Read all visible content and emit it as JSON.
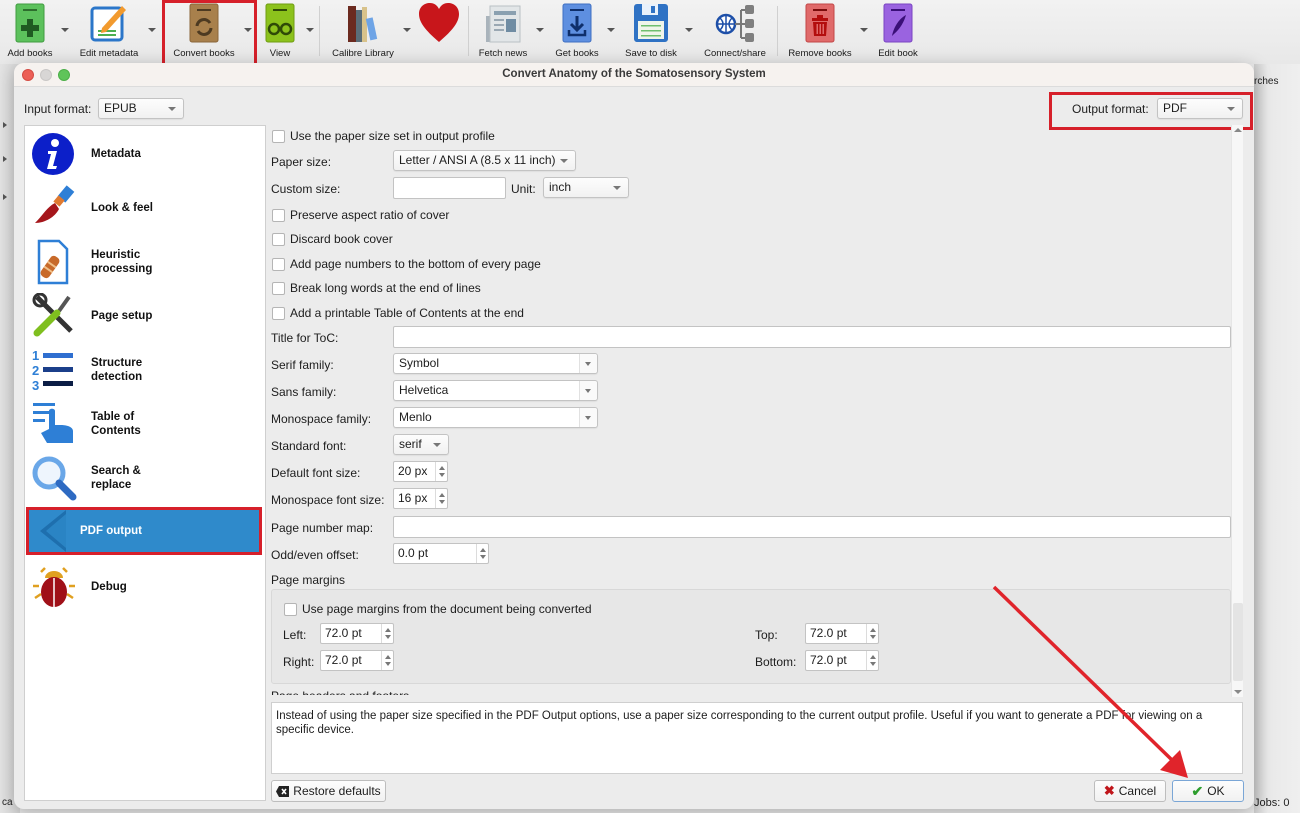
{
  "toolbar": {
    "items": [
      {
        "label": "Add books",
        "icon": "add-books-icon"
      },
      {
        "label": "Edit metadata",
        "icon": "edit-metadata-icon"
      },
      {
        "label": "Convert books",
        "icon": "convert-books-icon"
      },
      {
        "label": "View",
        "icon": "view-icon"
      },
      {
        "label": "Calibre Library",
        "icon": "library-icon"
      },
      {
        "label": "",
        "icon": "heart-icon"
      },
      {
        "label": "Fetch news",
        "icon": "fetch-news-icon"
      },
      {
        "label": "Get books",
        "icon": "get-books-icon"
      },
      {
        "label": "Save to disk",
        "icon": "save-to-disk-icon"
      },
      {
        "label": "Connect/share",
        "icon": "connect-share-icon"
      },
      {
        "label": "Remove books",
        "icon": "remove-books-icon"
      },
      {
        "label": "Edit book",
        "icon": "edit-book-icon"
      }
    ]
  },
  "background": {
    "searches_partial": "rches",
    "jobs": "Jobs: 0",
    "bottom_left_partial": "ca"
  },
  "dialog": {
    "title": "Convert Anatomy of the Somatosensory System",
    "input_format_label": "Input format:",
    "input_format_value": "EPUB",
    "output_format_label": "Output format:",
    "output_format_value": "PDF",
    "sidebar": [
      {
        "label": "Metadata",
        "icon": "info-icon"
      },
      {
        "label": "Look & feel",
        "icon": "paintbrush-icon"
      },
      {
        "label": "Heuristic processing",
        "icon": "bandage-document-icon"
      },
      {
        "label": "Page setup",
        "icon": "tools-icon"
      },
      {
        "label": "Structure detection",
        "icon": "numbered-list-icon"
      },
      {
        "label": "Table of Contents",
        "icon": "toc-hand-icon"
      },
      {
        "label": "Search & replace",
        "icon": "magnifier-icon"
      },
      {
        "label": "PDF output",
        "icon": "arrow-left-icon",
        "active": true
      },
      {
        "label": "Debug",
        "icon": "bug-icon"
      }
    ],
    "options": {
      "use_paper_size": "Use the paper size set in output profile",
      "paper_size_label": "Paper size:",
      "paper_size_value": "Letter / ANSI A (8.5 x 11 inch)",
      "custom_size_label": "Custom size:",
      "custom_size_value": "",
      "unit_label": "Unit:",
      "unit_value": "inch",
      "preserve_aspect": "Preserve aspect ratio of cover",
      "discard_cover": "Discard book cover",
      "add_page_numbers": "Add page numbers to the bottom of every page",
      "break_long_words": "Break long words at the end of lines",
      "add_toc": "Add a printable Table of Contents at the end",
      "toc_title_label": "Title for ToC:",
      "toc_title_value": "",
      "serif_label": "Serif family:",
      "serif_value": "Symbol",
      "sans_label": "Sans family:",
      "sans_value": "Helvetica",
      "mono_label": "Monospace family:",
      "mono_value": "Menlo",
      "std_font_label": "Standard font:",
      "std_font_value": "serif",
      "default_size_label": "Default font size:",
      "default_size_value": "20 px",
      "mono_size_label": "Monospace font size:",
      "mono_size_value": "16 px",
      "page_map_label": "Page number map:",
      "page_map_value": "",
      "offset_label": "Odd/even offset:",
      "offset_value": "0.0 pt",
      "margins_heading": "Page  margins",
      "use_doc_margins": "Use page margins from the document being converted",
      "left_label": "Left:",
      "left_value": "72.0 pt",
      "right_label": "Right:",
      "right_value": "72.0 pt",
      "top_label": "Top:",
      "top_value": "72.0 pt",
      "bottom_label": "Bottom:",
      "bottom_value": "72.0 pt",
      "headers_heading": "Page headers and footers"
    },
    "help_text": "Instead of using the paper size specified in the PDF Output options, use a paper size corresponding to the current output profile. Useful if you want to generate a PDF for viewing on a specific device.",
    "restore_defaults": "Restore defaults",
    "cancel": "Cancel",
    "ok": "OK"
  },
  "colors": {
    "highlight": "#d6202a",
    "selection": "#2f8acb"
  }
}
